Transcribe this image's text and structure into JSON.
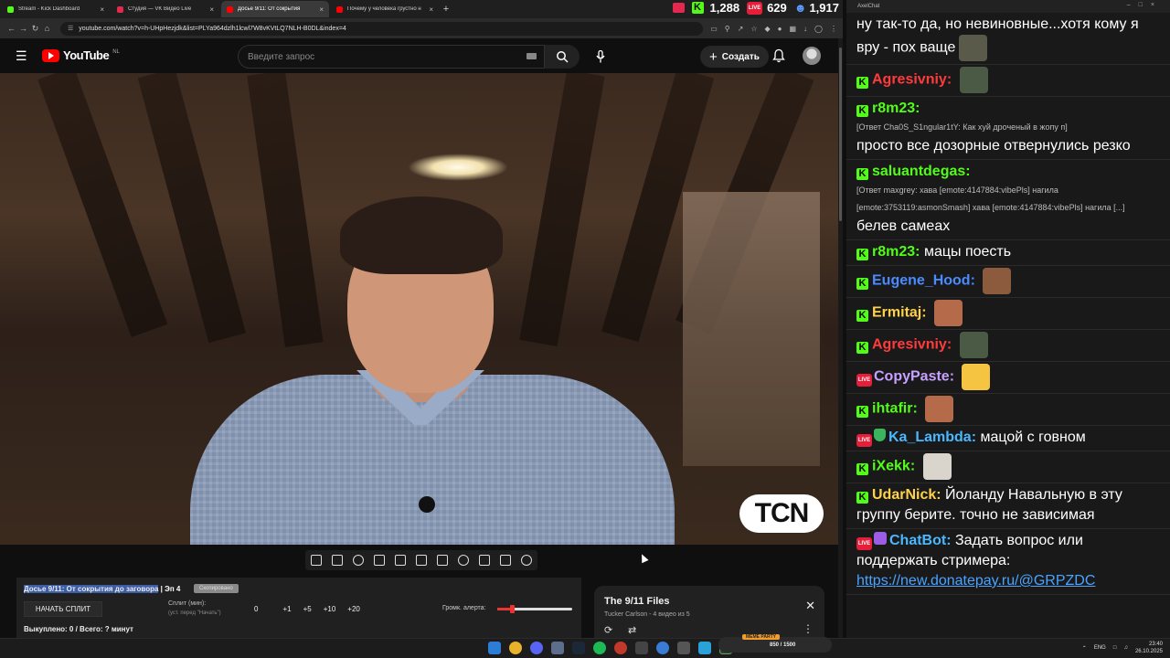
{
  "browser": {
    "tabs": [
      {
        "title": "Stream - Kick Dashboard",
        "color": "#53fc18",
        "active": false
      },
      {
        "title": "Студия — VK Видео Live",
        "color": "#e5294e",
        "active": false
      },
      {
        "title": "Досье 9/11: От сокрытия",
        "color": "#ff0000",
        "active": true
      },
      {
        "title": "Почему у человека грустно н",
        "color": "#ff0000",
        "active": false
      }
    ],
    "url": "youtube.com/watch?v=h-UHpHezjdk&list=PLYa964dzlh1lcwl7W8vKVtLQ7NLH-B0DL&index=4"
  },
  "stats": {
    "kick": "1,288",
    "vk": "629",
    "total": "1,917"
  },
  "youtube": {
    "logo_word": "YouTube",
    "country": "NL",
    "search_placeholder": "Введите запрос",
    "create_label": "Создать"
  },
  "video": {
    "watermark": "TCN"
  },
  "split": {
    "title": "Досье 9/11: От сокрытия до заговора",
    "episode": " | Эп 4",
    "badge": "Скопировано",
    "start_label": "НАЧАТЬ СПЛИТ",
    "split_label": "Сплит (мин):",
    "split_sub": "(уст. перед \"Начать\")",
    "nums": [
      "0",
      "+1",
      "+5",
      "+10",
      "+20"
    ],
    "alert_label": "Громк. алерта:",
    "alert_volume_fraction": 0.2,
    "footer": "Выкуплено: 0 / Всего: ? минут"
  },
  "playlist": {
    "title": "The 9/11 Files",
    "subtitle": "Tucker Carlson - 4 видео из 5"
  },
  "chat": {
    "app_title": "AxelChat",
    "messages": [
      {
        "id": "m0",
        "badges": [],
        "name": "",
        "name_color": "#ffffff",
        "reply": "",
        "text": "ну так-то да, но невиновные...хотя кому я вру - пох ваще",
        "emote": "#5a5a4a"
      },
      {
        "id": "m1",
        "badges": [
          "kick"
        ],
        "name": "Agresivniy:",
        "name_color": "#ff3b3b",
        "reply": "",
        "text": "",
        "emote": "#4a5a44"
      },
      {
        "id": "m2",
        "badges": [
          "kick"
        ],
        "name": "r8m23:",
        "name_color": "#53fc18",
        "reply": "[Ответ Cha0S_S1ngular1tY: Как хуй дроченый в жопу п]",
        "text": "просто все дозорные отвернулись резко",
        "emote": ""
      },
      {
        "id": "m3",
        "badges": [
          "kick"
        ],
        "name": "saluantdegas:",
        "name_color": "#53fc18",
        "reply": "[Ответ maxgrey: хава [emote:4147884:vibePls] нагила [emote:3753119:asmonSmash] хава [emote:4147884:vibePls] нагила [...]",
        "text": "белев самеах",
        "emote": ""
      },
      {
        "id": "m4",
        "badges": [
          "kick"
        ],
        "name": "r8m23:",
        "name_color": "#53fc18",
        "reply": "",
        "text": "мацы поесть",
        "emote": ""
      },
      {
        "id": "m5",
        "badges": [
          "kick"
        ],
        "name": "Eugene_Hood:",
        "name_color": "#4a8cff",
        "reply": "",
        "text": "",
        "emote": "#8c5a3c"
      },
      {
        "id": "m6",
        "badges": [
          "kick"
        ],
        "name": "Ermitaj:",
        "name_color": "#ffd24a",
        "reply": "",
        "text": "",
        "emote": "#b56a4a"
      },
      {
        "id": "m7",
        "badges": [
          "kick"
        ],
        "name": "Agresivniy:",
        "name_color": "#ff3b3b",
        "reply": "",
        "text": "",
        "emote": "#4a5a44"
      },
      {
        "id": "m8",
        "badges": [
          "live"
        ],
        "name": "CopyPaste:",
        "name_color": "#c8a0ff",
        "reply": "",
        "text": "",
        "emote": "#f5c542"
      },
      {
        "id": "m9",
        "badges": [
          "kick"
        ],
        "name": "ihtafir:",
        "name_color": "#53fc18",
        "reply": "",
        "text": "",
        "emote": "#b56a4a"
      },
      {
        "id": "m10",
        "badges": [
          "live",
          "shield"
        ],
        "name": "Ka_Lambda:",
        "name_color": "#4ab8ff",
        "reply": "",
        "text": "мацой с говном",
        "emote": ""
      },
      {
        "id": "m11",
        "badges": [
          "kick"
        ],
        "name": "iXekk:",
        "name_color": "#53fc18",
        "reply": "",
        "text": "",
        "emote": "#d9d4cc"
      },
      {
        "id": "m12",
        "badges": [
          "kick"
        ],
        "name": "UdarNick:",
        "name_color": "#ffd24a",
        "reply": "",
        "text": "Йоланду Навальную в эту группу берите. точно не зависимая",
        "emote": ""
      },
      {
        "id": "m13",
        "badges": [
          "live",
          "bot"
        ],
        "name": "ChatBot:",
        "name_color": "#4ab8ff",
        "reply": "",
        "text": "Задать вопрос или поддержать стримера:",
        "link": "https://new.donatepay.ru/@GRPZDC",
        "emote": ""
      }
    ]
  },
  "taskbar": {
    "party_label": "MEME PARTY",
    "party_value": "850 / 1500",
    "lang": "ENG",
    "time": "23:40",
    "date": "26.10.2025"
  }
}
